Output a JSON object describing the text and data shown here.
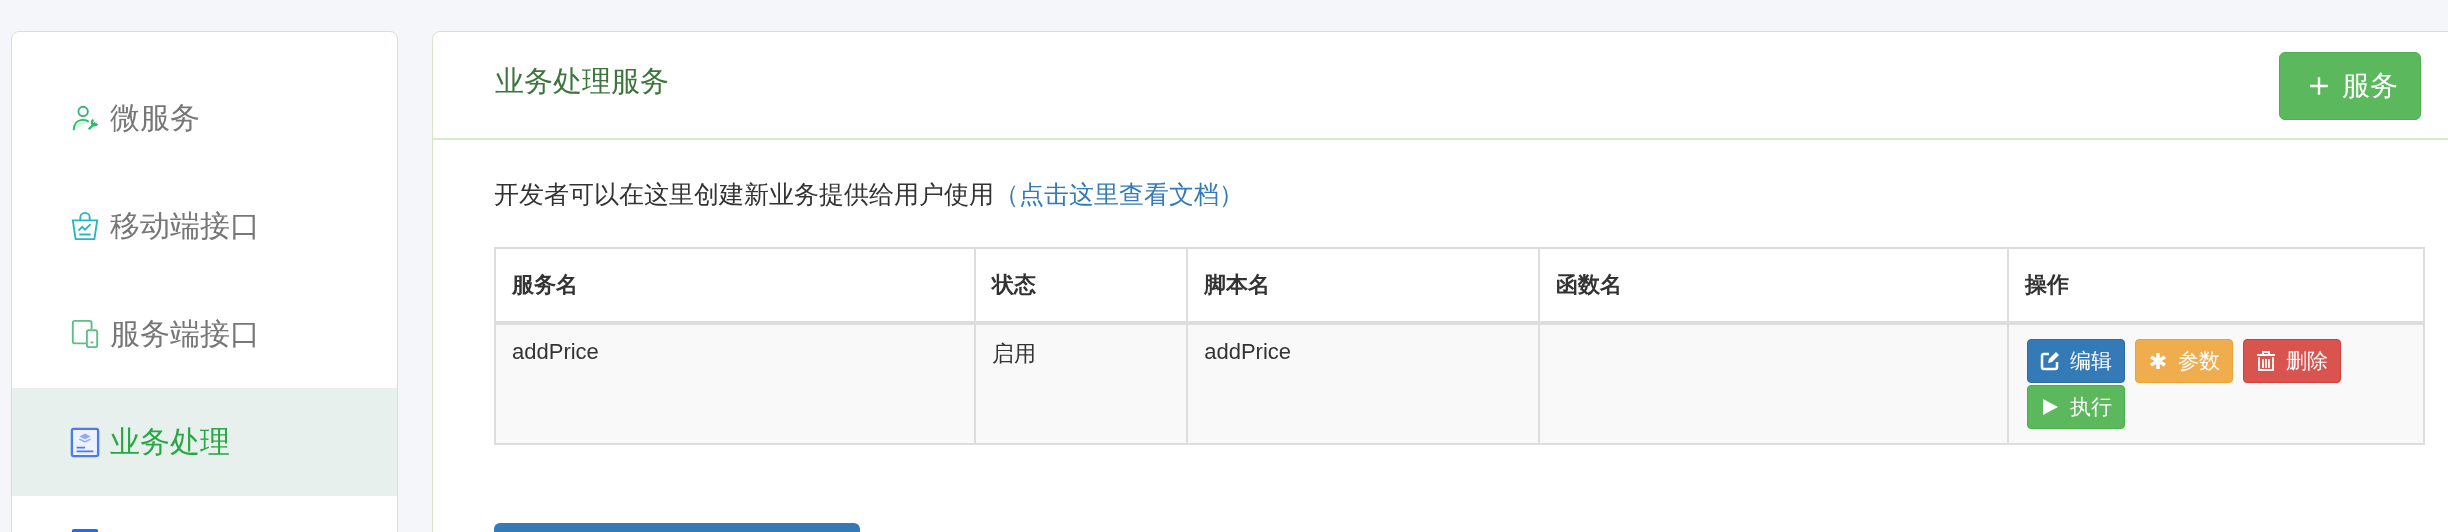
{
  "sidebar": {
    "items": [
      {
        "label": "微服务",
        "kind": "person-wrench",
        "selected": false
      },
      {
        "label": "移动端接口",
        "kind": "basket-chart",
        "selected": false
      },
      {
        "label": "服务端接口",
        "kind": "devices",
        "selected": false
      },
      {
        "label": "业务处理",
        "kind": "layers-doc",
        "selected": true
      },
      {
        "kind": "doc-blue",
        "selected": false
      }
    ]
  },
  "panel": {
    "title": "业务处理服务",
    "add_button": "服务",
    "description": "开发者可以在这里创建新业务提供给用户使用",
    "doc_link": "（点击这里查看文档）",
    "table": {
      "columns": [
        "服务名",
        "状态",
        "脚本名",
        "函数名",
        "操作"
      ],
      "rows": [
        {
          "service": "addPrice",
          "status": "启用",
          "script": "addPrice",
          "actions": [
            {
              "kind": "edit",
              "label": "编辑"
            },
            {
              "kind": "params",
              "label": "参数"
            },
            {
              "kind": "delete",
              "label": "删除"
            },
            {
              "kind": "run",
              "label": "执行"
            }
          ]
        }
      ]
    }
  }
}
